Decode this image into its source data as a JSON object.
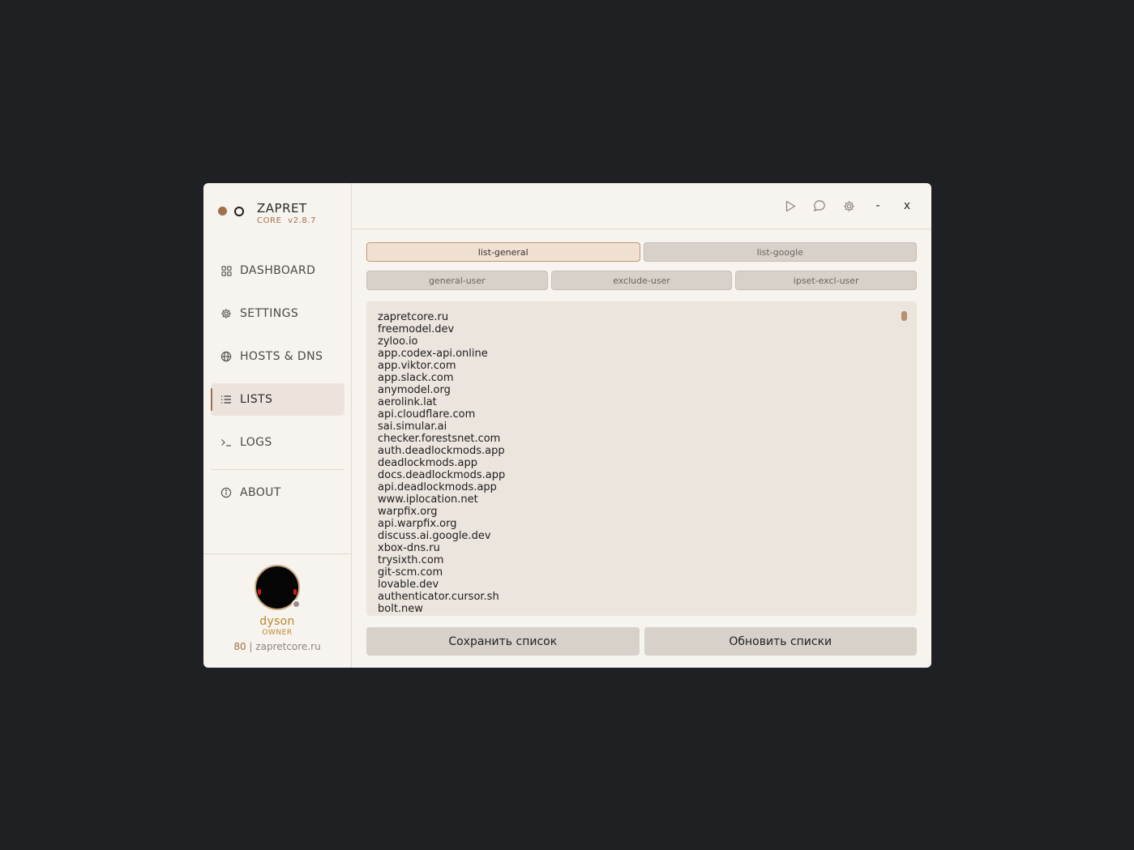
{
  "brand": {
    "name": "ZAPRET",
    "core_label": "CORE",
    "version": "v2.8.7"
  },
  "nav": {
    "dashboard": "DASHBOARD",
    "settings": "SETTINGS",
    "hosts_dns": "HOSTS & DNS",
    "lists": "LISTS",
    "logs": "LOGS",
    "about": "ABOUT"
  },
  "profile": {
    "name": "dyson",
    "role": "OWNER",
    "count": "80",
    "separator": "|",
    "site": "zapretcore.ru"
  },
  "topbar": {
    "minimize": "-",
    "close": "x"
  },
  "tabs": {
    "list_general": "list-general",
    "list_google": "list-google",
    "general_user": "general-user",
    "exclude_user": "exclude-user",
    "ipset_excl_user": "ipset-excl-user"
  },
  "editor": {
    "content": "zapretcore.ru\nfreemodel.dev\nzyloo.io\napp.codex-api.online\napp.viktor.com\napp.slack.com\nanymodel.org\naerolink.lat\napi.cloudflare.com\nsai.simular.ai\nchecker.forestsnet.com\nauth.deadlockmods.app\ndeadlockmods.app\ndocs.deadlockmods.app\napi.deadlockmods.app\nwww.iplocation.net\nwarpfix.org\napi.warpfix.org\ndiscuss.ai.google.dev\nxbox-dns.ru\ntrysixth.com\ngit-scm.com\nlovable.dev\nauthenticator.cursor.sh\nbolt.new"
  },
  "actions": {
    "save": "Сохранить список",
    "update": "Обновить списки"
  },
  "colors": {
    "accent": "#a0704c",
    "background": "#f7f3ee",
    "page": "#1f2024",
    "gold": "#b88a2a"
  }
}
